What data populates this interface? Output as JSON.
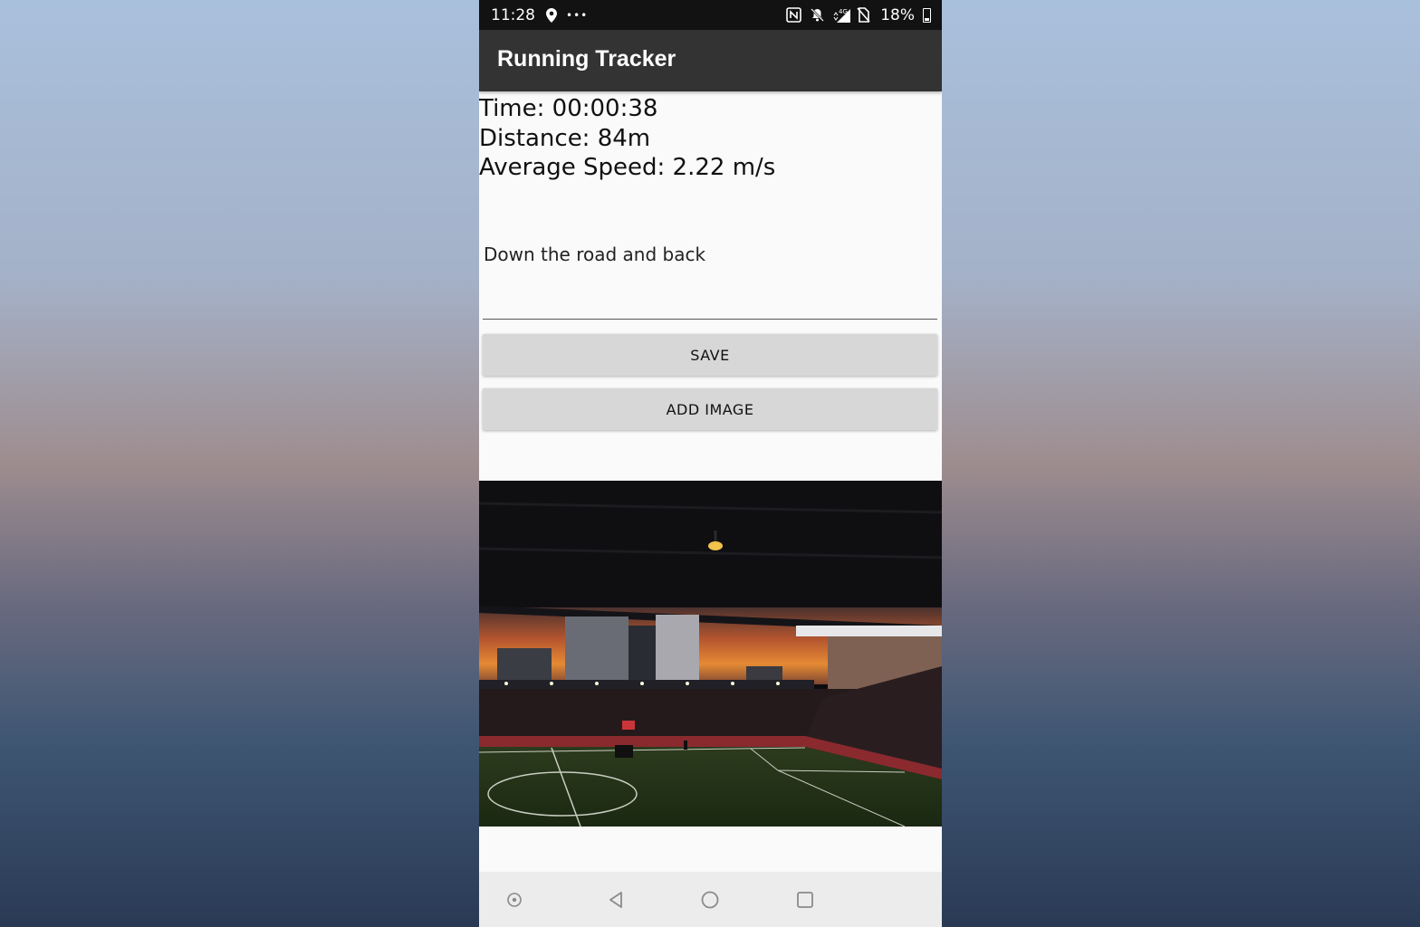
{
  "status_bar": {
    "time": "11:28",
    "dots": "•••",
    "network": "4G",
    "battery": "18%",
    "icons": [
      "location-icon",
      "nfc-icon",
      "mute-icon",
      "signal-icon",
      "no-sim-icon",
      "battery-icon"
    ]
  },
  "app_bar": {
    "title": "Running Tracker"
  },
  "stats": {
    "time": "Time: 00:00:38",
    "distance": "Distance: 84m",
    "average_speed": "Average Speed: 2.22 m/s"
  },
  "note": {
    "value": "Down the road and back"
  },
  "buttons": {
    "save": "SAVE",
    "add_image": "ADD IMAGE"
  },
  "photo": {
    "subject": "stadium-sunset-photo"
  },
  "nav_bar": {
    "icons": [
      "assist-icon",
      "back-icon",
      "home-icon",
      "recents-icon"
    ]
  },
  "colors": {
    "status_bar_bg": "#121212",
    "app_bar_bg": "#333333",
    "content_bg": "#fafafa",
    "button_bg": "#d7d7d7",
    "nav_bar_bg": "#ececec"
  }
}
